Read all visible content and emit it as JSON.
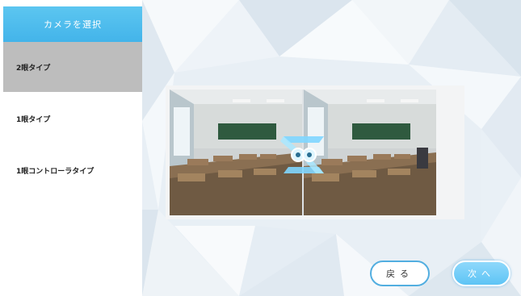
{
  "sidebar": {
    "header": "カメラを選択",
    "items": [
      {
        "label": "2眼タイプ",
        "selected": true
      },
      {
        "label": "1眼タイプ",
        "selected": false
      },
      {
        "label": "1眼コントローラタイプ",
        "selected": false
      }
    ]
  },
  "buttons": {
    "back_label": "戻る",
    "next_label": "次へ"
  },
  "preview": {
    "image": "classroom-stereo-preview",
    "overlay_icon": "camera-swap-icon"
  },
  "colors": {
    "accent": "#43b4ea",
    "selected_item": "#bdbdbd",
    "next_button": "#6fcaf6"
  }
}
